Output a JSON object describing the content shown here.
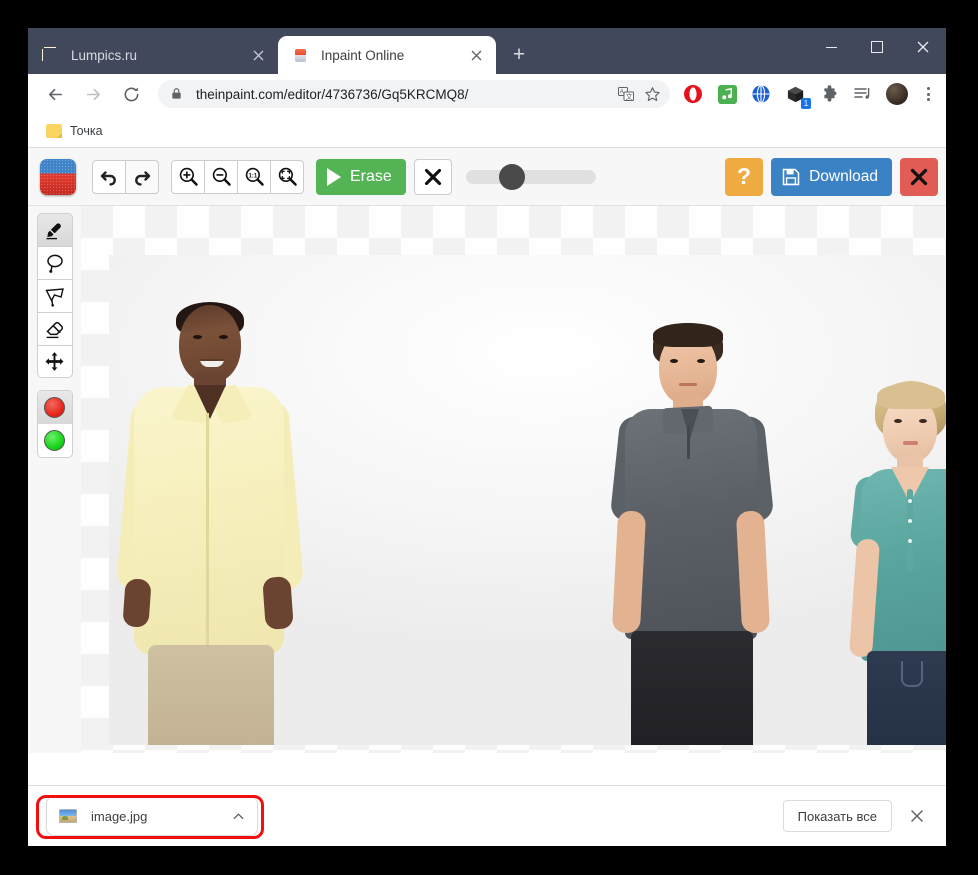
{
  "browser": {
    "tabs": [
      {
        "title": "Lumpics.ru",
        "favicon": "orange-icon",
        "active": false
      },
      {
        "title": "Inpaint Online",
        "favicon": "eraser-icon",
        "active": true
      }
    ],
    "new_tab_label": "+",
    "window_controls": {
      "minimize": "minimize-icon",
      "maximize": "maximize-icon",
      "close": "close-icon"
    },
    "nav": {
      "back": "back-arrow-icon",
      "forward": "forward-arrow-icon",
      "reload": "reload-icon"
    },
    "omnibox": {
      "lock": "lock-icon",
      "url": "theinpaint.com/editor/4736736/Gq5KRCMQ8/",
      "translate": "translate-icon",
      "bookmark": "star-icon"
    },
    "extensions": [
      {
        "name": "opera-icon",
        "badge": ""
      },
      {
        "name": "music-note-icon",
        "badge": ""
      },
      {
        "name": "globe-icon",
        "badge": ""
      },
      {
        "name": "box-icon",
        "badge": "1"
      },
      {
        "name": "puzzle-icon",
        "badge": ""
      },
      {
        "name": "playlist-icon",
        "badge": ""
      }
    ],
    "profile": "avatar",
    "menu": "kebab-menu-icon",
    "bookmarks": [
      {
        "label": "Точка",
        "icon": "folder-icon"
      }
    ]
  },
  "app": {
    "logo": "inpaint-logo-icon",
    "history": [
      {
        "name": "undo-button",
        "icon": "undo-arrow-icon"
      },
      {
        "name": "redo-button",
        "icon": "redo-arrow-icon"
      }
    ],
    "zoom_tools": [
      {
        "name": "zoom-in-button",
        "icon": "magnifier-plus-icon"
      },
      {
        "name": "zoom-out-button",
        "icon": "magnifier-minus-icon"
      },
      {
        "name": "zoom-actual-button",
        "icon": "magnifier-1to1-icon"
      },
      {
        "name": "zoom-fit-button",
        "icon": "magnifier-fit-icon"
      }
    ],
    "erase_label": "Erase",
    "cancel_icon": "x-icon",
    "slider": {
      "value": 25,
      "min": 0,
      "max": 100
    },
    "help_label": "?",
    "download_label": "Download",
    "close_icon": "x-icon",
    "tools": [
      {
        "name": "marker-tool",
        "icon": "marker-icon",
        "selected": true
      },
      {
        "name": "lasso-tool",
        "icon": "lasso-icon",
        "selected": false
      },
      {
        "name": "polygon-lasso-tool",
        "icon": "polygon-lasso-icon",
        "selected": false
      },
      {
        "name": "eraser-tool",
        "icon": "eraser-icon",
        "selected": false
      },
      {
        "name": "move-tool",
        "icon": "move-arrows-icon",
        "selected": false
      }
    ],
    "swatches": [
      {
        "name": "red-swatch",
        "color": "#e8271a",
        "selected": true
      },
      {
        "name": "green-swatch",
        "color": "#17d417",
        "selected": false
      }
    ],
    "canvas": {
      "description": "photo of three people standing against a white background with a red brush mask stroke near the bottom",
      "mask_color": "#f4625c"
    }
  },
  "download_shelf": {
    "file_name": "image.jpg",
    "expand_icon": "chevron-up-icon",
    "show_all_label": "Показать все",
    "close_icon": "close-icon",
    "highlight_color": "#f01010"
  }
}
